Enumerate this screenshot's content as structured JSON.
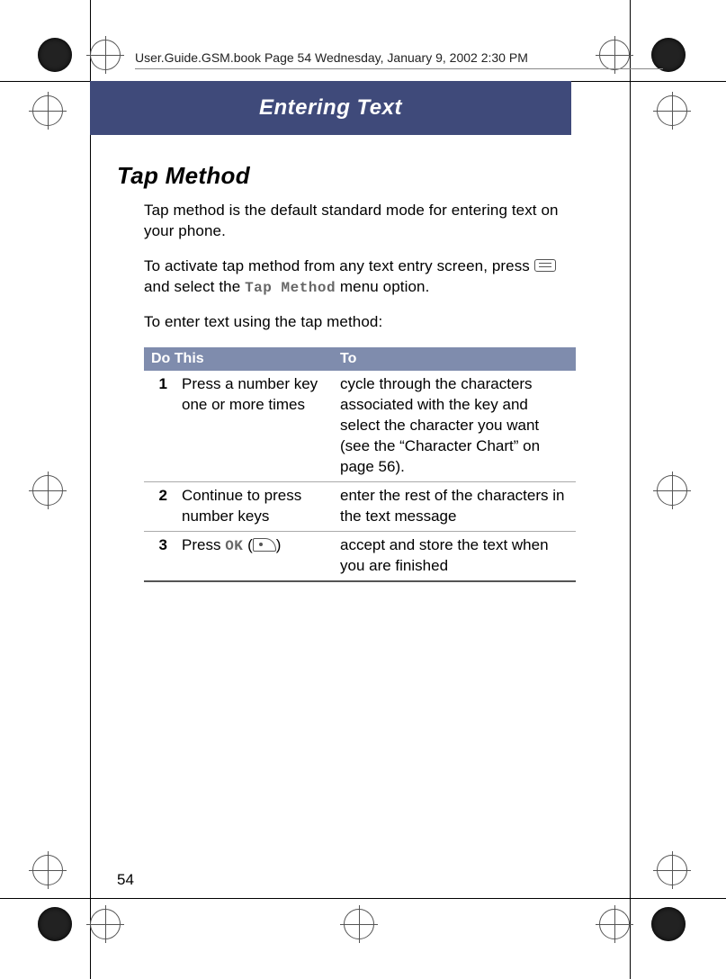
{
  "header": {
    "running": "User.Guide.GSM.book  Page 54  Wednesday, January 9, 2002  2:30 PM"
  },
  "banner": "Entering Text",
  "section_heading": "Tap Method",
  "paragraphs": {
    "p1": "Tap method is the default standard mode for entering text on your phone.",
    "p2a": "To activate tap method from any text entry screen, press ",
    "p2b": " and select the ",
    "p2_code": "Tap Method",
    "p2c": " menu option.",
    "p3": "To enter text using the tap method:"
  },
  "table": {
    "col1": "Do This",
    "col2": "To",
    "rows": [
      {
        "n": "1",
        "do": "Press a number key one or more times",
        "to": "cycle through the characters associated with the key and select the character you want (see the “Character Chart” on page 56)."
      },
      {
        "n": "2",
        "do": "Continue to press number keys",
        "to": "enter the rest of the characters in the text message"
      },
      {
        "n": "3",
        "do_a": "Press ",
        "do_code": "OK",
        "do_b": " (",
        "do_c": ")",
        "to": "accept and store the text when you are finished"
      }
    ]
  },
  "page_number": "54"
}
